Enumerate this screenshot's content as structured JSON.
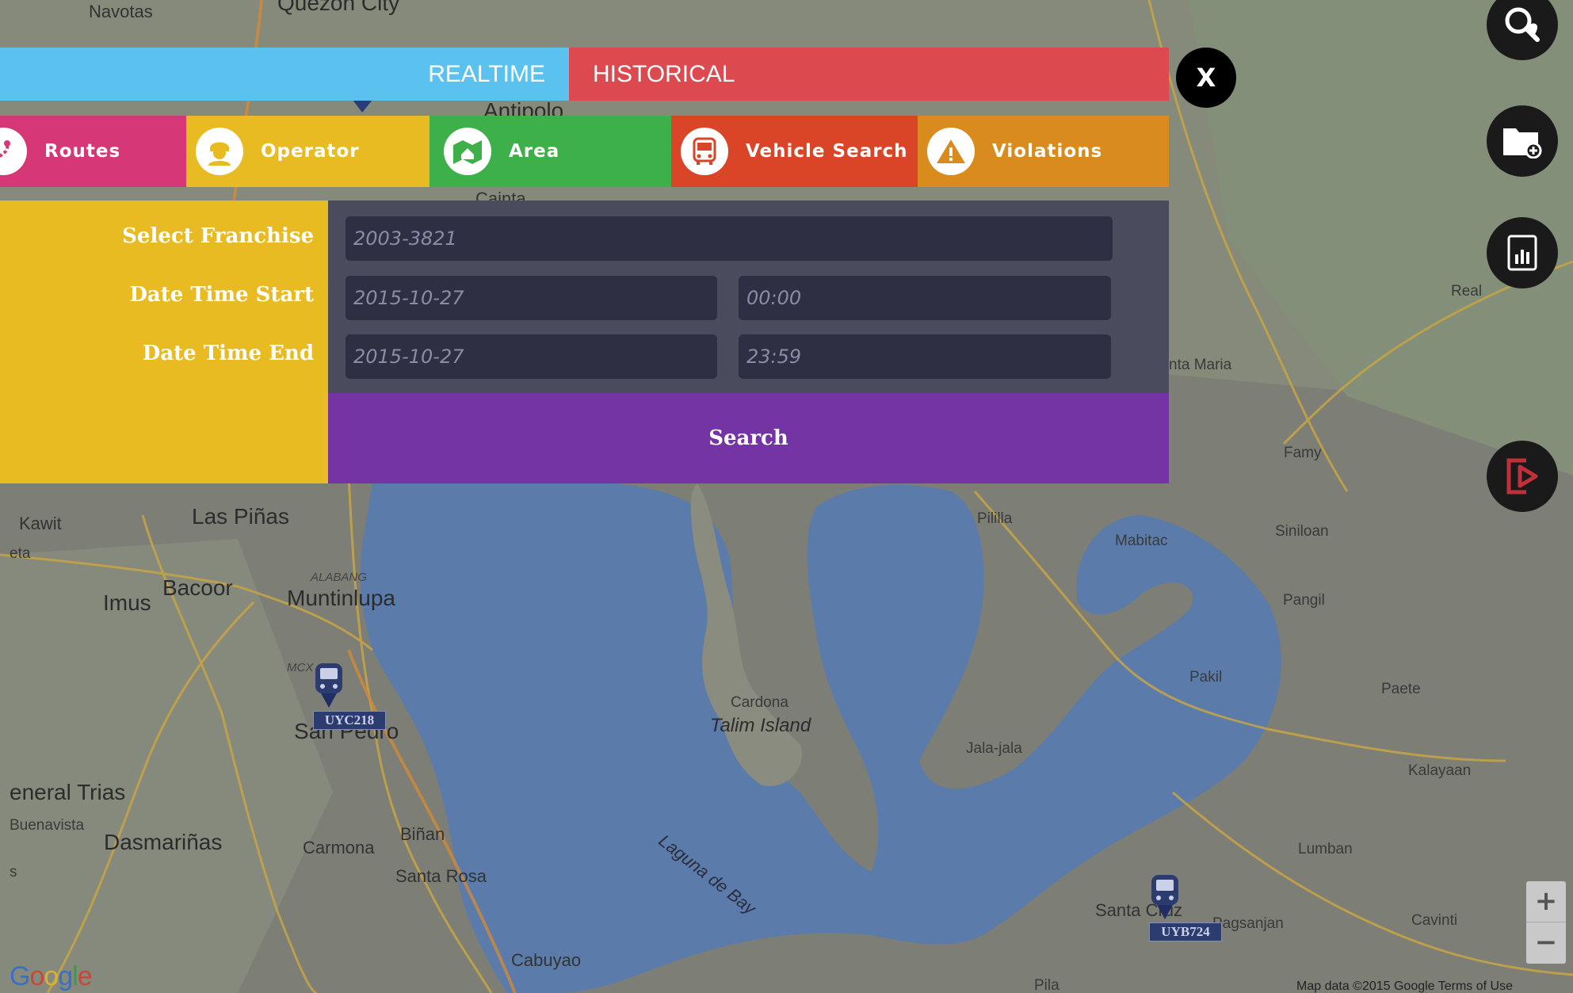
{
  "tabs": {
    "realtime_label": "REALTIME",
    "historical_label": "HISTORICAL",
    "close_label": "X"
  },
  "categories": [
    {
      "label": "Routes",
      "icon": "route-icon",
      "color": "#d63877"
    },
    {
      "label": "Operator",
      "icon": "operator-icon",
      "color": "#e8bb22"
    },
    {
      "label": "Area",
      "icon": "area-map-icon",
      "color": "#3eb04a"
    },
    {
      "label": "Vehicle Search",
      "icon": "bus-icon",
      "color": "#d94526"
    },
    {
      "label": "Violations",
      "icon": "warning-icon",
      "color": "#d98c1d"
    }
  ],
  "form": {
    "franchise_label": "Select Franchise",
    "start_label": "Date Time Start",
    "end_label": "Date Time End",
    "franchise_value": "2003-3821",
    "start_date": "2015-10-27",
    "start_time": "00:00",
    "end_date": "2015-10-27",
    "end_time": "23:59",
    "search_label": "Search"
  },
  "side_buttons": [
    {
      "icon": "search-location-icon"
    },
    {
      "icon": "folder-add-icon"
    },
    {
      "icon": "report-chart-icon"
    },
    {
      "icon": "logout-icon",
      "color": "#c0303a"
    }
  ],
  "map": {
    "labels": {
      "navotas": "Navotas",
      "quezon": "Quezon City",
      "antipolo": "Antipolo",
      "cainta": "Cainta",
      "kawit": "Kawit",
      "eta": "eta",
      "las_pinas": "Las Piñas",
      "bacoor": "Bacoor",
      "imus": "Imus",
      "alabang": "ALABANG",
      "muntinlupa": "Muntinlupa",
      "mcx": "MCX",
      "san_pedro": "San Pedro",
      "general_trias": "eneral Trias",
      "buenavista": "Buenavista",
      "dasmarinas": "Dasmariñas",
      "carmona": "Carmona",
      "binan": "Biñan",
      "santa_rosa": "Santa Rosa",
      "cabuyao": "Cabuyao",
      "cardona": "Cardona",
      "talim": "Talim Island",
      "laguna": "Laguna de Bay",
      "pililla": "Pililla",
      "mabitac": "Mabitac",
      "siniloan": "Siniloan",
      "famy": "Famy",
      "real": "Real",
      "santa_maria": "nta Maria",
      "pangil": "Pangil",
      "pakil": "Pakil",
      "paete": "Paete",
      "jala_jala": "Jala-jala",
      "kalayaan": "Kalayaan",
      "lumban": "Lumban",
      "santa_cruz": "Santa Cruz",
      "pagsanjan": "Pagsanjan",
      "cavinti": "Cavinti",
      "pila": "Pila",
      "s": "s"
    },
    "vehicles": [
      {
        "plate": "UYC218"
      },
      {
        "plate": "UYB724"
      }
    ],
    "google": "Google",
    "copyright": "Map data ©2015 Google   Terms of Use",
    "zoom_in": "+",
    "zoom_out": "−",
    "water_color": "#5b7bab",
    "land_color": "#8a8a80"
  }
}
